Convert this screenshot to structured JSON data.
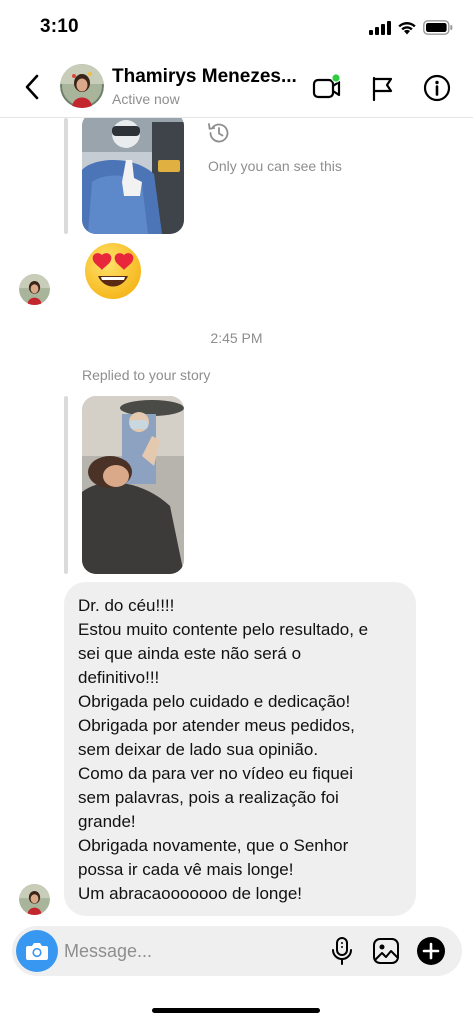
{
  "status_bar": {
    "time": "3:10",
    "icons": [
      "cellular-signal-icon",
      "wifi-icon",
      "battery-icon"
    ]
  },
  "header": {
    "name": "Thamirys Menezes...",
    "status": "Active now",
    "icons": [
      "back-chevron-icon",
      "video-call-icon",
      "flag-icon",
      "info-icon"
    ],
    "online_dot_color": "#2ecc40"
  },
  "thread": {
    "only_you_note": "Only you can see this",
    "emoji": "heart-eyes-emoji",
    "timestamp": "2:45 PM",
    "replied_label": "Replied to your story",
    "message_lines": [
      "Dr. do céu!!!!",
      "Estou muito contente pelo resultado, e",
      "sei que ainda este não será o",
      "definitivo!!!",
      "Obrigada pelo cuidado e dedicação!",
      "Obrigada por atender meus pedidos,",
      "sem deixar de lado sua opinião.",
      "Como da para ver no vídeo eu fiquei",
      "sem palavras, pois a realização foi",
      "grande!",
      "Obrigada novamente, que o Senhor",
      "possa ir cada vê mais longe!",
      "Um abracaooooooo de longe!"
    ]
  },
  "composer": {
    "placeholder": "Message...",
    "icons": [
      "camera-icon",
      "microphone-icon",
      "gallery-icon",
      "add-icon"
    ],
    "camera_color": "#3897f0"
  },
  "colors": {
    "bubble_bg": "#efefef",
    "muted_text": "#8e8e8e"
  }
}
